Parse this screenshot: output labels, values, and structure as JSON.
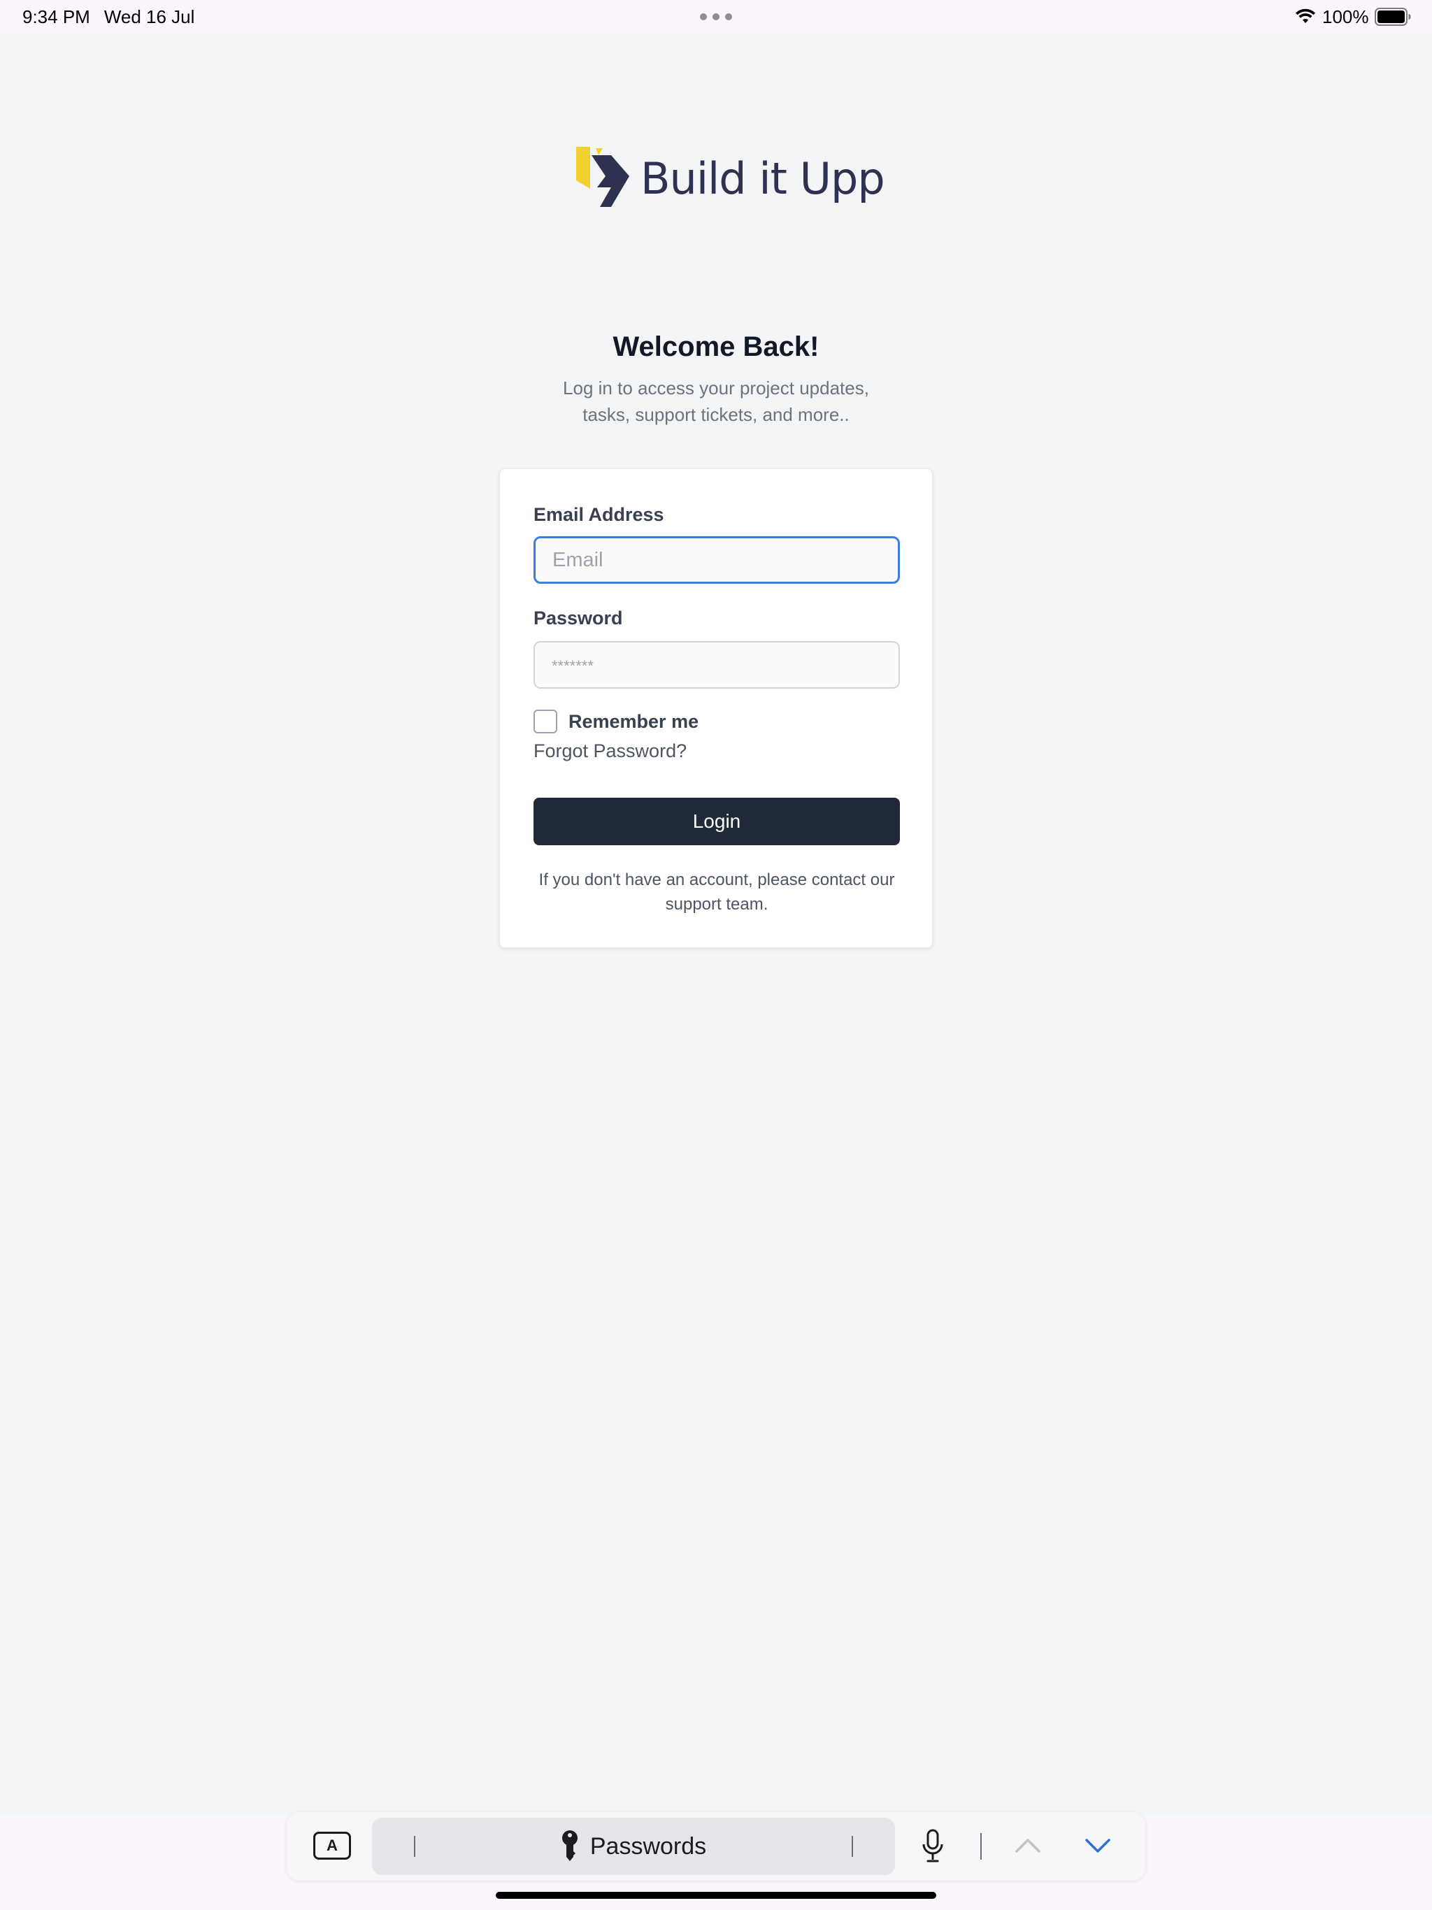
{
  "status_bar": {
    "time": "9:34 PM",
    "date": "Wed 16 Jul",
    "battery": "100%"
  },
  "brand": {
    "name": "Build it Upp",
    "colors": {
      "yellow": "#f2d12e",
      "navy": "#2e3150"
    }
  },
  "welcome": {
    "title": "Welcome Back!",
    "subtitle": "Log in to access your project updates, tasks, support tickets, and more.."
  },
  "form": {
    "email_label": "Email Address",
    "email_placeholder": "Email",
    "password_label": "Password",
    "password_placeholder": "*******",
    "remember_label": "Remember me",
    "remember_checked": false,
    "forgot_link": "Forgot Password?",
    "login_button": "Login",
    "note": "If you don't have an account, please contact our support team."
  },
  "keyboard_bar": {
    "passwords_label": "Passwords",
    "a_label": "A",
    "icons": [
      "text-format-icon",
      "key-icon",
      "mic-icon",
      "chevron-up-icon",
      "chevron-down-icon"
    ]
  },
  "colors": {
    "background": "#f3f4f6",
    "button": "#1f2937",
    "focus_border": "#3b7de0"
  }
}
